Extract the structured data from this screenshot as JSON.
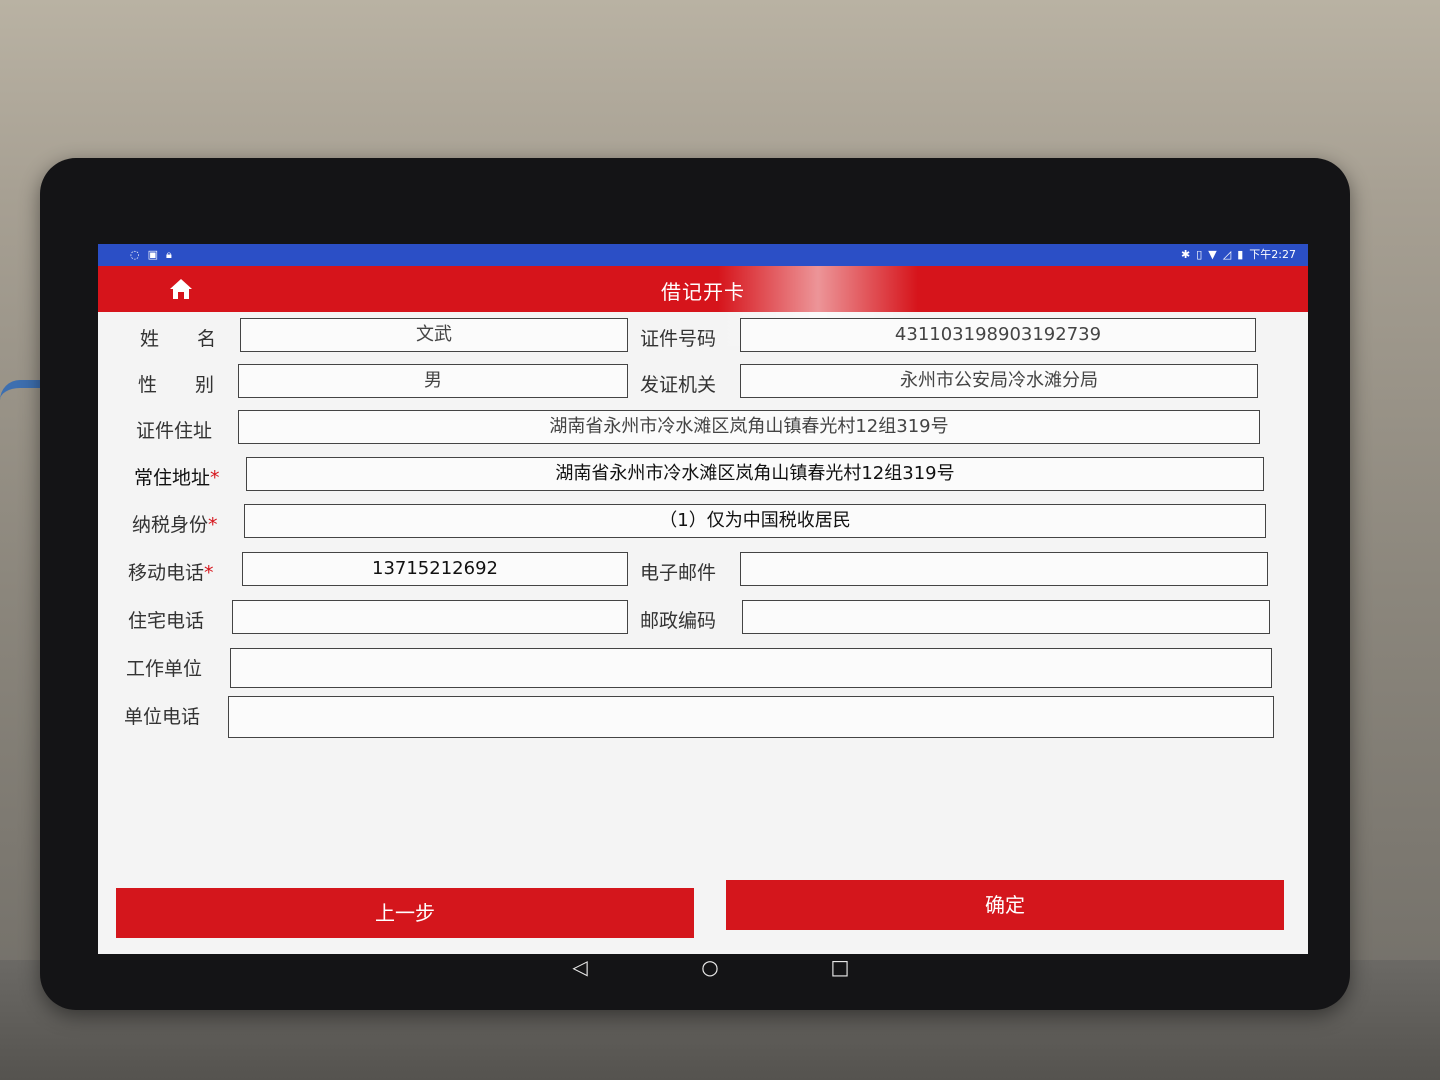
{
  "status_bar": {
    "left_icons": [
      "notification-icon",
      "app-icon",
      "lock-icon"
    ],
    "right_icons": [
      "bluetooth-icon",
      "vibrate-icon",
      "wifi-icon",
      "signal-icon",
      "battery-icon"
    ],
    "time": "下午2:27"
  },
  "title_bar": {
    "title": "借记开卡",
    "home_icon": "home-icon"
  },
  "form": {
    "name": {
      "label": "姓　　名",
      "value": "文武"
    },
    "id_number": {
      "label": "证件号码",
      "value": "431103198903192739"
    },
    "gender": {
      "label": "性　　别",
      "value": "男"
    },
    "issuing_authority": {
      "label": "发证机关",
      "value": "永州市公安局冷水滩分局"
    },
    "id_address": {
      "label": "证件住址",
      "value": "湖南省永州市冷水滩区岚角山镇春光村12组319号"
    },
    "residence_address": {
      "label": "常住地址",
      "required": "*",
      "value": "湖南省永州市冷水滩区岚角山镇春光村12组319号"
    },
    "tax_status": {
      "label": "纳税身份",
      "required": "*",
      "value": "（1）仅为中国税收居民"
    },
    "mobile": {
      "label": "移动电话",
      "required": "*",
      "value": "13715212692"
    },
    "email": {
      "label": "电子邮件",
      "value": ""
    },
    "home_phone": {
      "label": "住宅电话",
      "value": ""
    },
    "postal_code": {
      "label": "邮政编码",
      "value": ""
    },
    "employer": {
      "label": "工作单位",
      "value": ""
    },
    "work_phone": {
      "label": "单位电话",
      "value": ""
    }
  },
  "buttons": {
    "prev": "上一步",
    "confirm": "确定"
  },
  "system_nav": {
    "back": "◁",
    "home": "○",
    "recents": "□"
  },
  "colors": {
    "status_bar": "#2b4fc6",
    "title_bar": "#d6141b",
    "button": "#d4161c",
    "required": "#d6141b"
  }
}
